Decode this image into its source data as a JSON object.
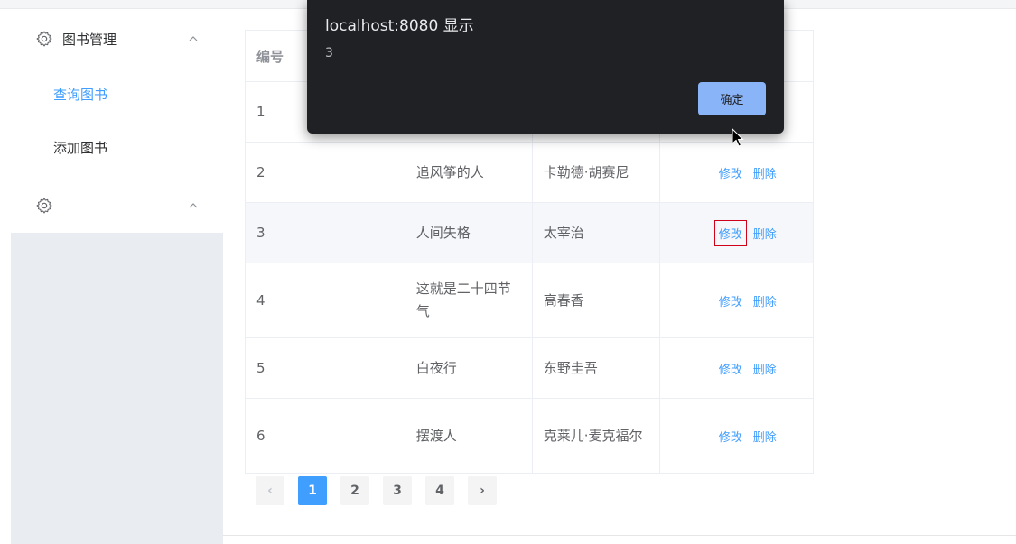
{
  "sidebar": {
    "menu_title": "图书管理",
    "items": [
      {
        "label": "查询图书",
        "active": true
      },
      {
        "label": "添加图书",
        "active": false
      }
    ],
    "second_menu_title": ""
  },
  "table": {
    "headers": [
      "编号",
      "",
      "",
      ""
    ],
    "rows": [
      {
        "id": "1",
        "name": "",
        "author": "",
        "edit": "",
        "delete": ""
      },
      {
        "id": "2",
        "name": "追风筝的人",
        "author": "卡勒德·胡赛尼",
        "edit": "修改",
        "delete": "删除"
      },
      {
        "id": "3",
        "name": "人间失格",
        "author": "太宰治",
        "edit": "修改",
        "delete": "删除"
      },
      {
        "id": "4",
        "name": "这就是二十四节气",
        "author": "高春香",
        "edit": "修改",
        "delete": "删除"
      },
      {
        "id": "5",
        "name": "白夜行",
        "author": "东野圭吾",
        "edit": "修改",
        "delete": "删除"
      },
      {
        "id": "6",
        "name": "摆渡人",
        "author": "克莱儿·麦克福尔",
        "edit": "修改",
        "delete": "删除"
      }
    ]
  },
  "pagination": {
    "prev": "‹",
    "pages": [
      "1",
      "2",
      "3",
      "4"
    ],
    "current": "1",
    "next": "›"
  },
  "dialog": {
    "title": "localhost:8080 显示",
    "message": "3",
    "ok_label": "确定"
  },
  "colors": {
    "accent": "#409eff",
    "dialog_bg": "#202124",
    "dialog_button": "#8ab4f8",
    "highlight_box": "#d0021b"
  },
  "icons": {
    "menu_icon": "gear-icon",
    "collapse_icon": "chevron-up-icon",
    "pager_prev": "chevron-left-icon",
    "pager_next": "chevron-right-icon"
  }
}
